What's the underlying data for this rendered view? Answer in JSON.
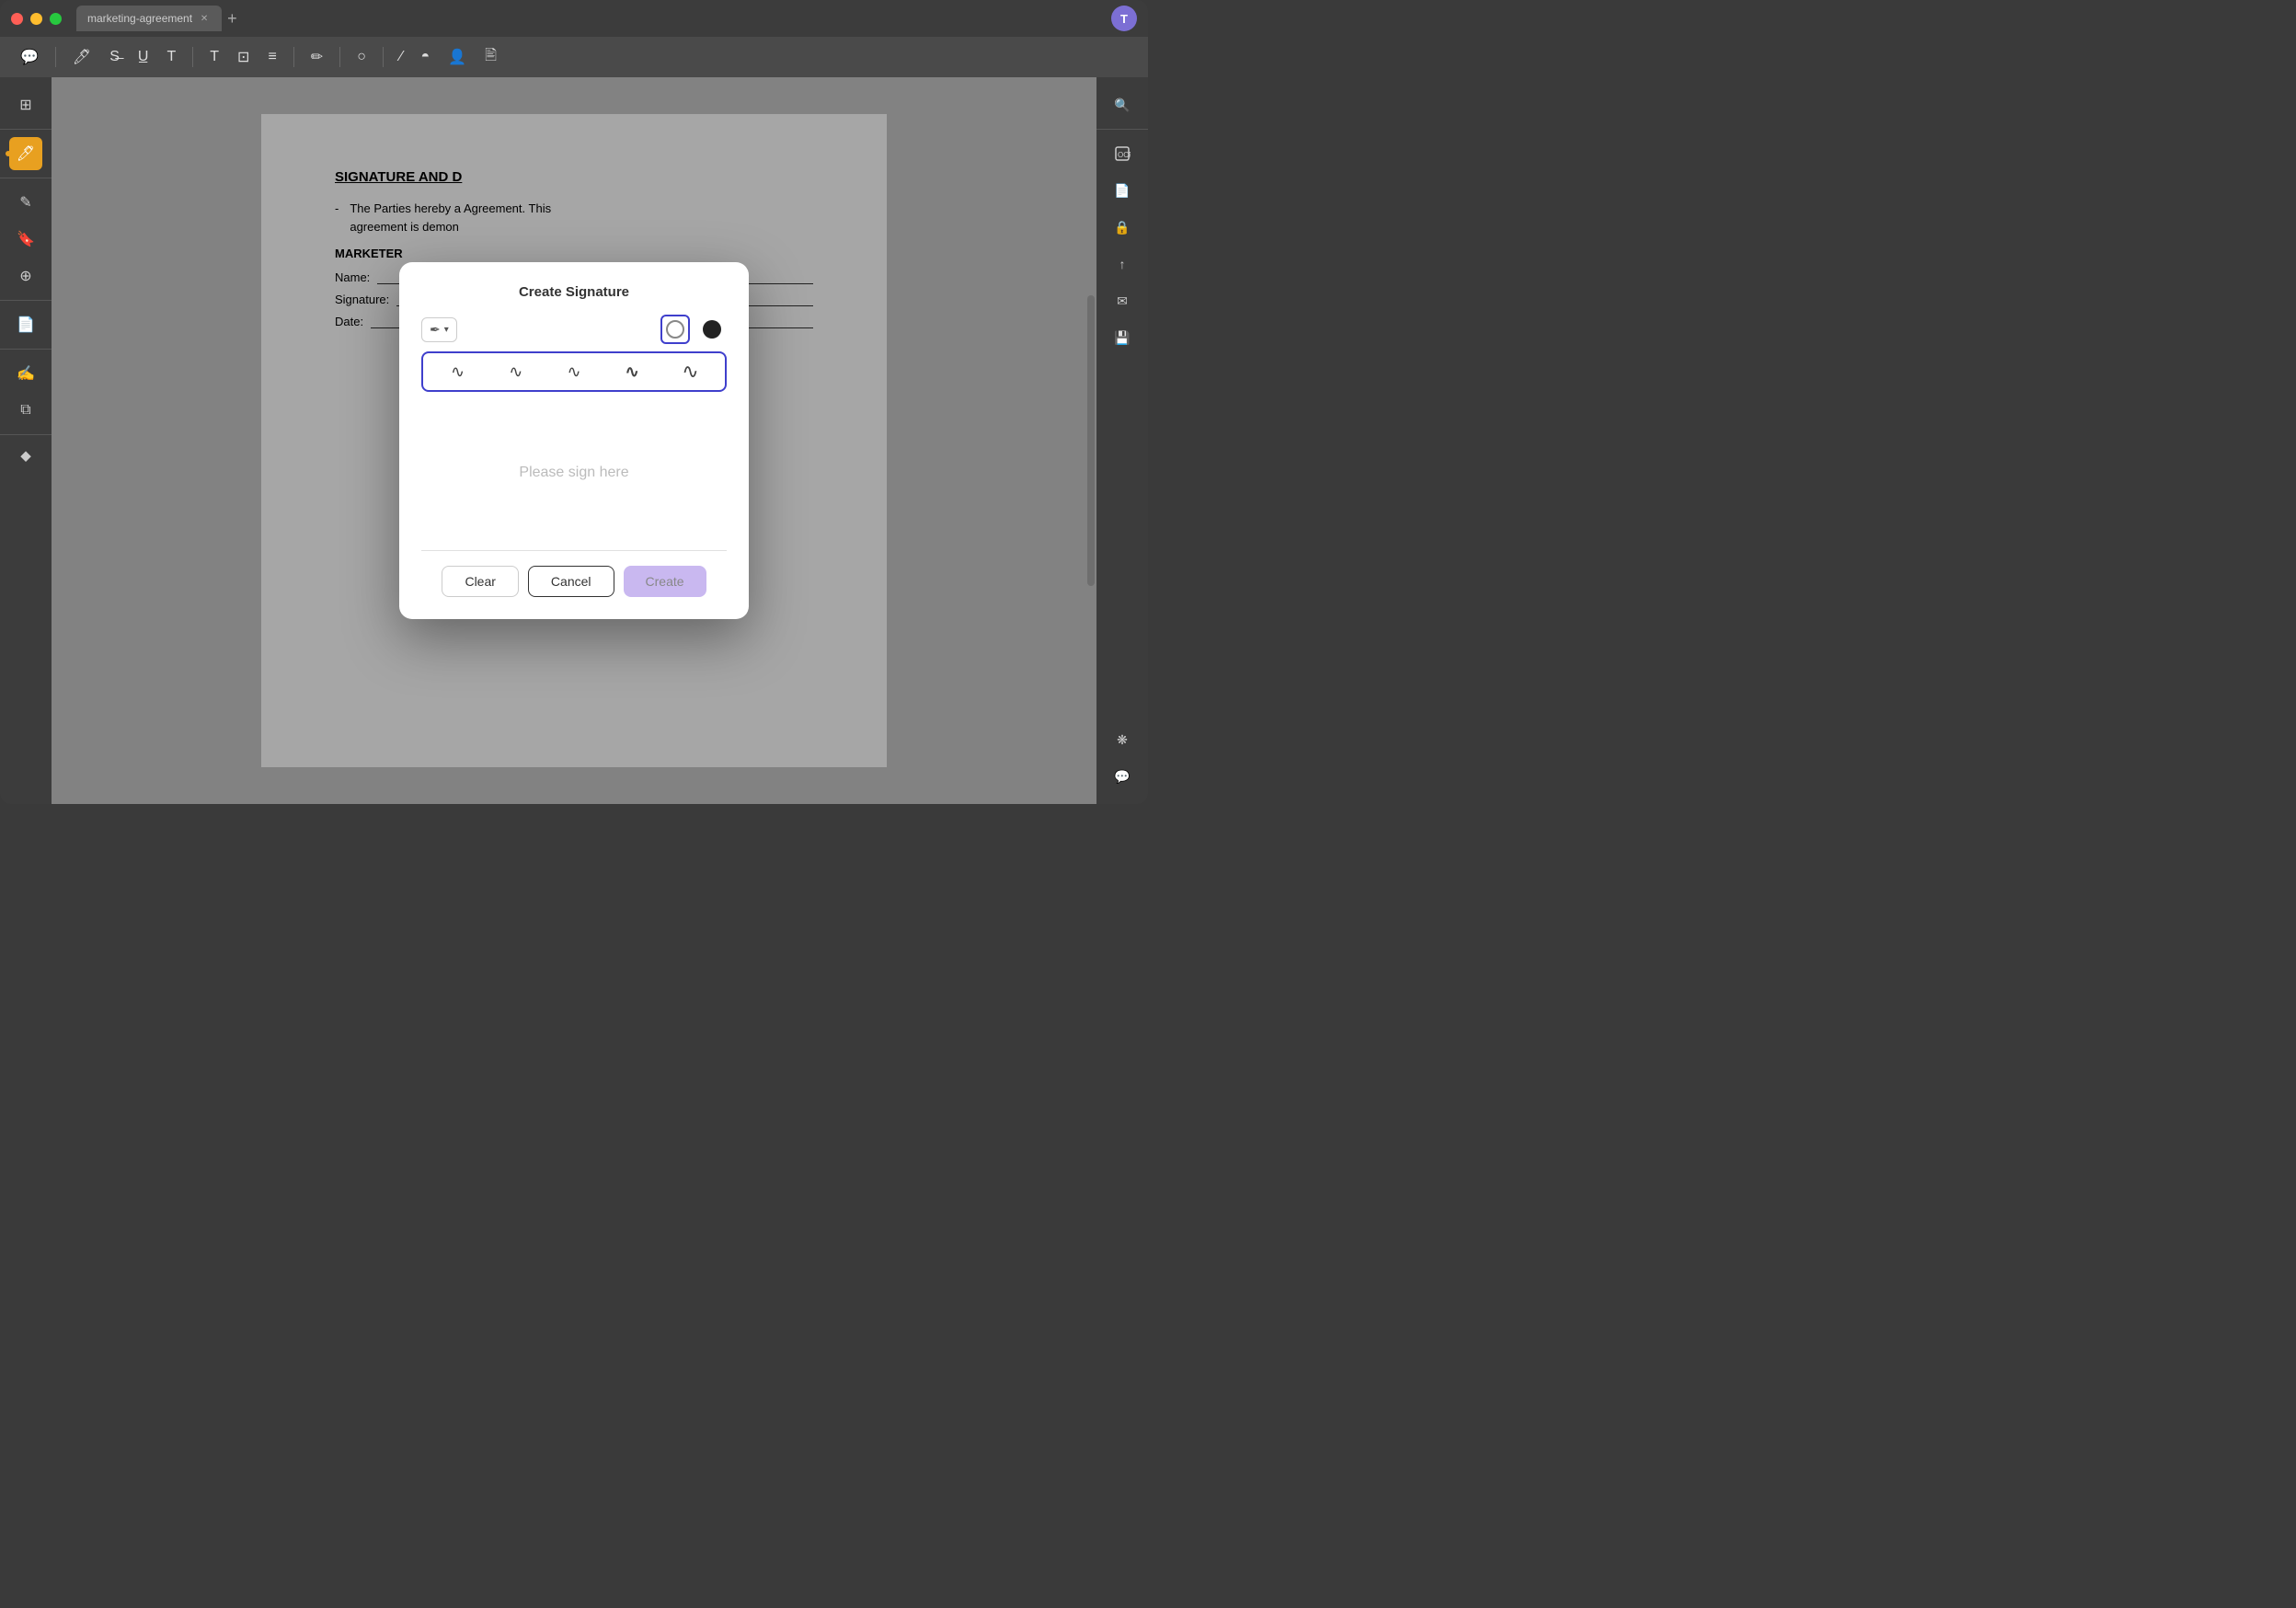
{
  "window": {
    "title": "marketing-agreement",
    "user_initial": "T"
  },
  "toolbar": {
    "icons": [
      "comment",
      "highlight",
      "strikethrough",
      "underline",
      "text-insert",
      "text-size",
      "text-box",
      "align",
      "pen",
      "shape",
      "line",
      "color-fill",
      "signature",
      "stamp"
    ]
  },
  "left_sidebar": {
    "icons": [
      "thumbnail",
      "separator",
      "search",
      "separator2",
      "annotation",
      "bookmark",
      "layer",
      "separator3",
      "pages",
      "separator4",
      "signature-panel",
      "layers2",
      "separator5",
      "bookmark2"
    ]
  },
  "document": {
    "section_title": "SIGNATURE AND D",
    "list_dash": "-",
    "list_text": "The Parties hereby a",
    "list_text2": "agreement is demon",
    "agreement_suffix": "Agreement. This",
    "marketer_label": "MARKETER",
    "name_label": "Name:",
    "signature_label": "Signature:",
    "date_label": "Date:"
  },
  "modal": {
    "title": "Create Signature",
    "pen_selector_icon": "✒",
    "color_transparent": "○",
    "color_black": "●",
    "line_styles": [
      "~",
      "~",
      "~",
      "~",
      "~"
    ],
    "sign_placeholder": "Please sign here",
    "btn_clear": "Clear",
    "btn_cancel": "Cancel",
    "btn_create": "Create"
  },
  "right_sidebar": {
    "icons": [
      "ocr",
      "doc-convert",
      "secure",
      "export",
      "mail",
      "save-version"
    ]
  }
}
